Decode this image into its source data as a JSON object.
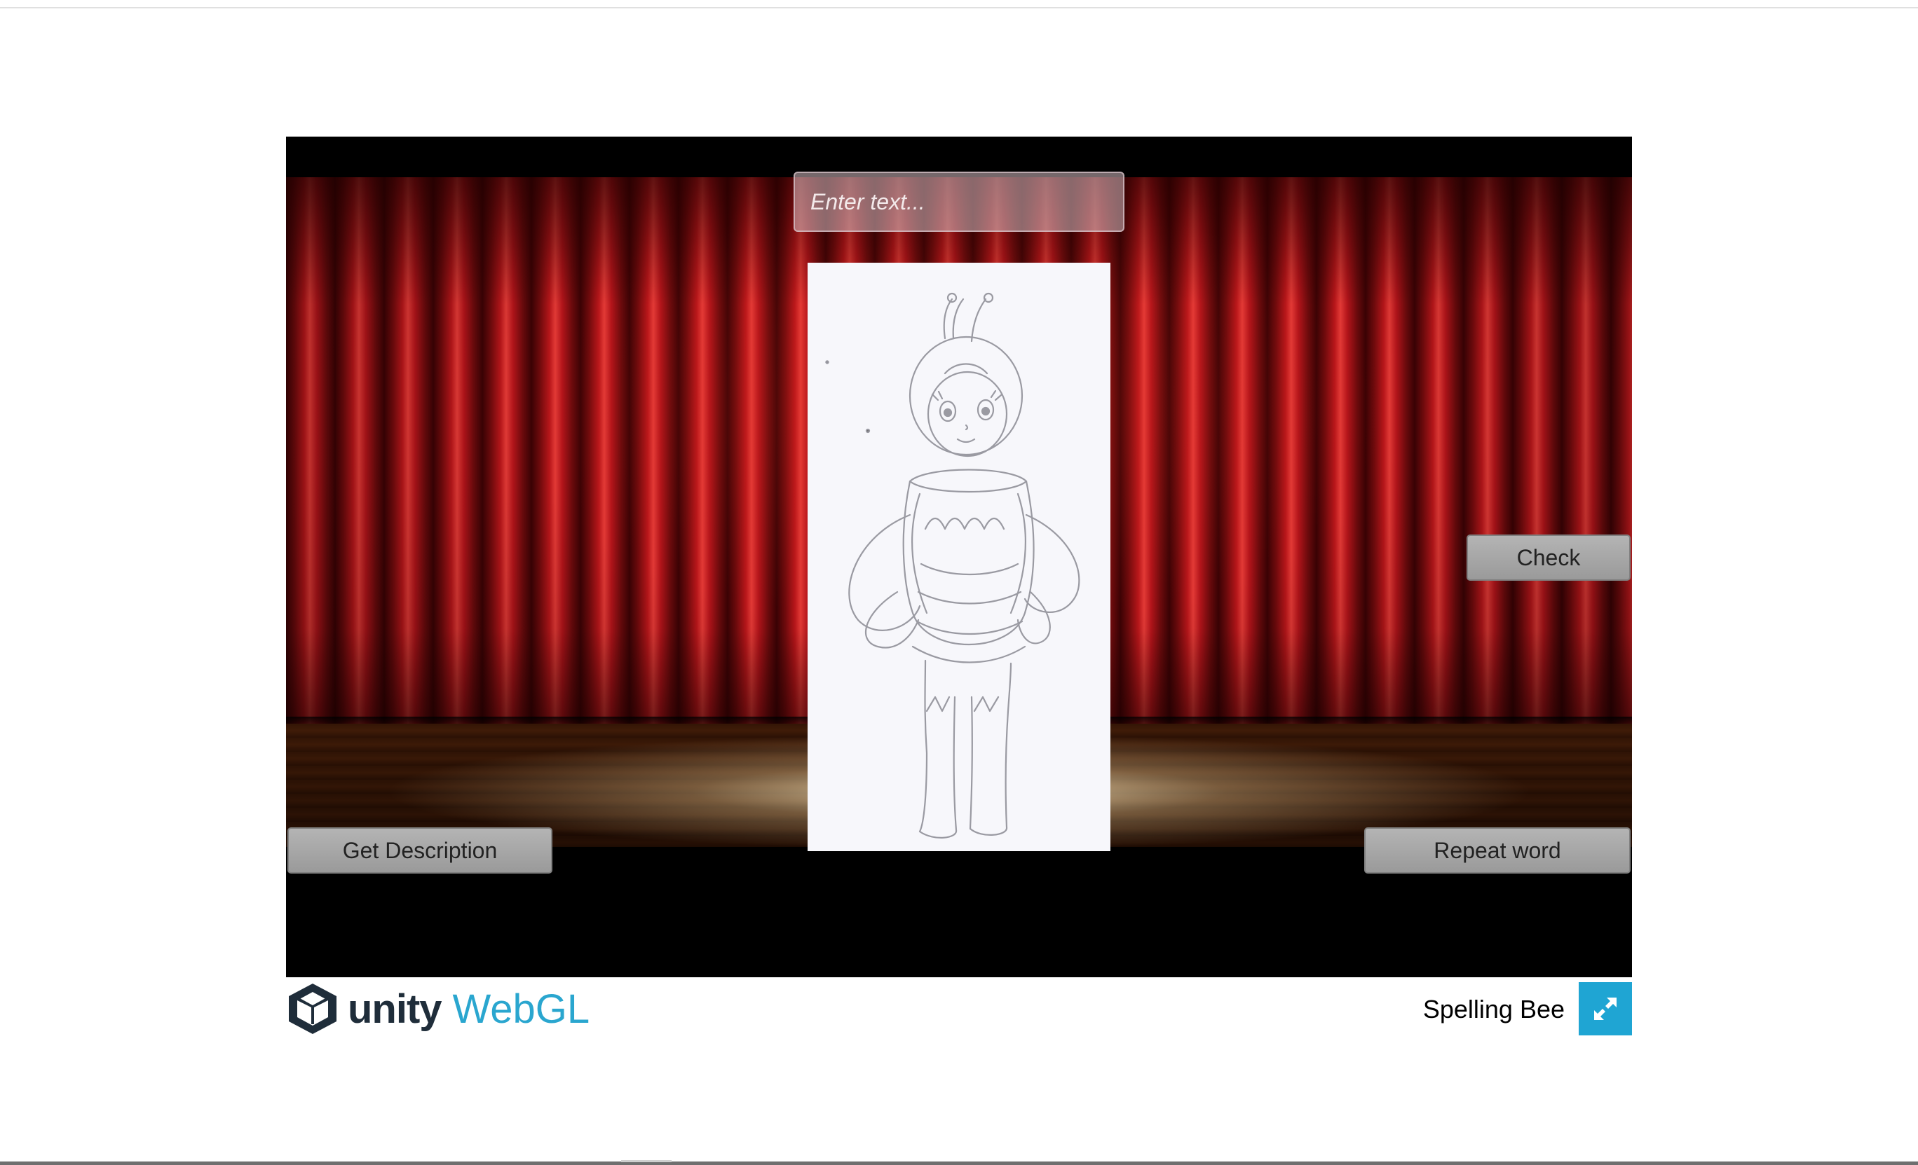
{
  "game": {
    "input": {
      "placeholder": "Enter text...",
      "value": ""
    },
    "buttons": {
      "check": "Check",
      "get_description": "Get Description",
      "repeat_word": "Repeat word"
    },
    "image_subject": "pencil sketch of a bee costume character"
  },
  "footer": {
    "logo_unity": "unity",
    "logo_webgl": "WebGL",
    "title": "Spelling Bee",
    "fullscreen_icon": "expand-icon"
  },
  "colors": {
    "curtain": "#b8161a",
    "button": "#a6a6a6",
    "accent": "#1fa5d3",
    "webgl_text": "#2aa6cf"
  }
}
